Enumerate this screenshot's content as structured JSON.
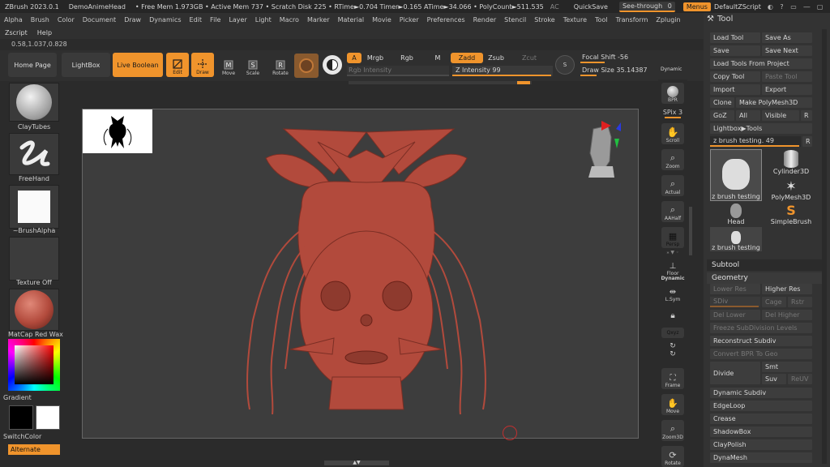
{
  "titlebar": {
    "app": "ZBrush 2023.0.1",
    "doc": "DemoAnimeHead",
    "stats": "• Free Mem 1.973GB • Active Mem 737 • Scratch Disk 225 • RTime►0.704 Timer►0.165 ATime►34.066 • PolyCount►511.535",
    "ac": "AC",
    "quicksave": "QuickSave",
    "seethrough": "See-through",
    "seethrough_value": "0",
    "menus": "Menus",
    "script": "DefaultZScript"
  },
  "menubar": [
    "Alpha",
    "Brush",
    "Color",
    "Document",
    "Draw",
    "Dynamics",
    "Edit",
    "File",
    "Layer",
    "Light",
    "Macro",
    "Marker",
    "Material",
    "Movie",
    "Picker",
    "Preferences",
    "Render",
    "Stencil",
    "Stroke",
    "Texture",
    "Tool",
    "Transform",
    "Zplugin"
  ],
  "menubar2": [
    "Zscript",
    "Help"
  ],
  "coords": "0.58,1.037,0.828",
  "shelf": {
    "home": "Home Page",
    "lightbox": "LightBox",
    "liveboolean": "Live Boolean",
    "edit": "Edit",
    "draw": "Draw",
    "move": "Move",
    "scale": "Scale",
    "rotate": "Rotate",
    "a": "A",
    "mrgb": "Mrgb",
    "rgb": "Rgb",
    "m": "M",
    "rgb_intensity": "Rgb Intensity",
    "zadd": "Zadd",
    "zsub": "Zsub",
    "zcut": "Zcut",
    "z_intensity": "Z Intensity 99",
    "focal_shift": "Focal Shift -56",
    "draw_size": "Draw Size 35.14387",
    "dynamic": "Dynamic",
    "s": "S"
  },
  "leftshelf": {
    "brush": "ClayTubes",
    "stroke": "FreeHand",
    "alpha": "~BrushAlpha",
    "texture": "Texture Off",
    "material": "MatCap Red Wax",
    "gradient": "Gradient",
    "switchcolor": "SwitchColor",
    "alternate": "Alternate"
  },
  "rightshelf": {
    "bpr": "BPR",
    "spix": "SPix 3",
    "scroll": "Scroll",
    "zoom": "Zoom",
    "actual": "Actual",
    "aahalf": "AAHalf",
    "persp": "Persp",
    "floor": "Floor",
    "dynamic": "Dynamic",
    "lsym": "L.Sym",
    "xyz": "Qxyz",
    "frame": "Frame",
    "move": "Move",
    "zoom3d": "Zoom3D",
    "rotate": "Rotate"
  },
  "tool": {
    "title": "Tool",
    "load": "Load Tool",
    "saveas": "Save As",
    "save": "Save",
    "savenext": "Save Next",
    "loadproj": "Load Tools From Project",
    "copy": "Copy Tool",
    "paste": "Paste Tool",
    "import": "Import",
    "export": "Export",
    "clone": "Clone",
    "makepoly": "Make PolyMesh3D",
    "goz": "GoZ",
    "all": "All",
    "visible": "Visible",
    "r": "R",
    "lightboxtools": "Lightbox▶Tools",
    "current": "z brush testing. 49",
    "thumbs": [
      "z brush testing",
      "Cylinder3D",
      "PolyMesh3D",
      "Head",
      "SimpleBrush",
      "z brush testing"
    ],
    "subtool": "Subtool",
    "geometry": "Geometry",
    "lowerres": "Lower Res",
    "higherres": "Higher Res",
    "sdiv": "SDiv",
    "cage": "Cage",
    "rstr": "Rstr",
    "dellower": "Del Lower",
    "delhigher": "Del Higher",
    "freeze": "Freeze SubDivision Levels",
    "reconstruct": "Reconstruct Subdiv",
    "convertbpr": "Convert BPR To Geo",
    "divide": "Divide",
    "smt": "Smt",
    "suv": "Suv",
    "reuv": "ReUV",
    "dynsubdiv": "Dynamic Subdiv",
    "edgeloop": "EdgeLoop",
    "crease": "Crease",
    "shadowbox": "ShadowBox",
    "claypolish": "ClayPolish",
    "dynamesh": "DynaMesh"
  },
  "colors": {
    "accent": "#f0942c",
    "model": "#b24a3c",
    "bg": "#2b2b2b"
  }
}
